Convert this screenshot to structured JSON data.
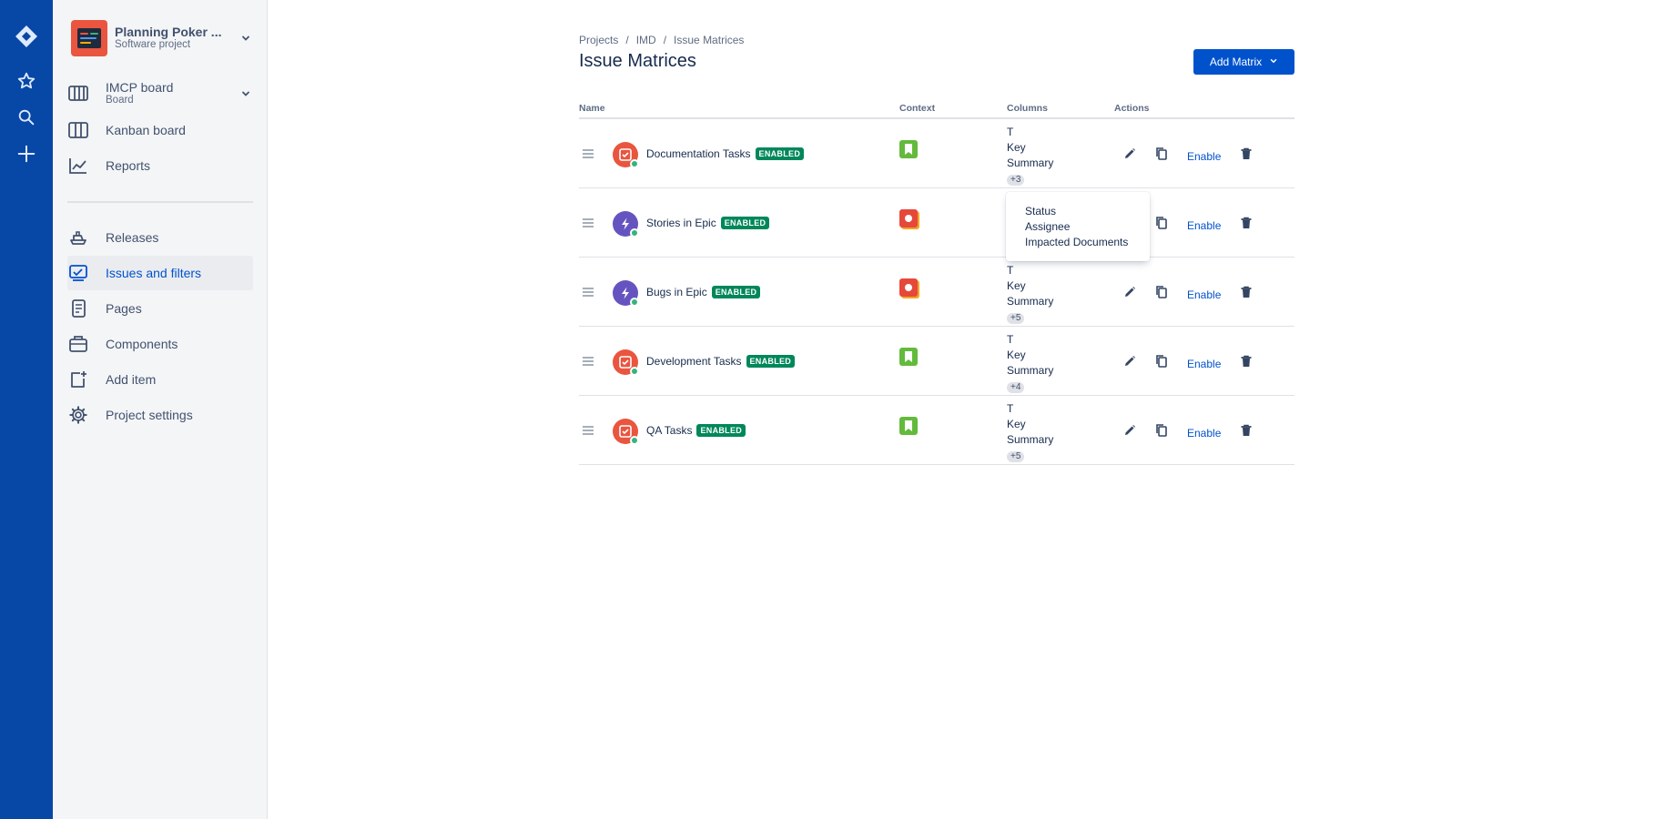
{
  "rail": {
    "items": [
      {
        "name": "jira-logo-icon"
      },
      {
        "name": "starred-icon"
      },
      {
        "name": "search-icon"
      },
      {
        "name": "create-icon"
      }
    ]
  },
  "sidebar": {
    "project": {
      "name": "Planning Poker ...",
      "type": "Software project"
    },
    "board": {
      "name": "IMCP board",
      "type": "Board"
    },
    "items": [
      {
        "label": "Kanban board",
        "icon": "kanban-icon"
      },
      {
        "label": "Reports",
        "icon": "reports-icon"
      },
      {
        "label": "Releases",
        "icon": "releases-icon"
      },
      {
        "label": "Issues and filters",
        "icon": "issues-icon",
        "active": true
      },
      {
        "label": "Pages",
        "icon": "pages-icon"
      },
      {
        "label": "Components",
        "icon": "components-icon"
      },
      {
        "label": "Add item",
        "icon": "add-item-icon"
      },
      {
        "label": "Project settings",
        "icon": "settings-icon"
      }
    ]
  },
  "breadcrumb": {
    "items": [
      "Projects",
      "IMD",
      "Issue Matrices"
    ],
    "separator": "/"
  },
  "page": {
    "title": "Issue Matrices",
    "add_button": "Add Matrix"
  },
  "table": {
    "headers": {
      "name": "Name",
      "context": "Context",
      "columns": "Columns",
      "actions": "Actions"
    },
    "status_label": "ENABLED",
    "enable_label": "Enable",
    "rows": [
      {
        "name": "Documentation Tasks",
        "issue_type": "task",
        "context": "story",
        "columns": [
          "T",
          "Key",
          "Summary"
        ],
        "more": "+3"
      },
      {
        "name": "Stories in Epic",
        "issue_type": "epic",
        "context": "bug",
        "columns": [],
        "more": ""
      },
      {
        "name": "Bugs in Epic",
        "issue_type": "epic",
        "context": "bug",
        "columns": [
          "T",
          "Key",
          "Summary"
        ],
        "more": "+5"
      },
      {
        "name": "Development Tasks",
        "issue_type": "task",
        "context": "story",
        "columns": [
          "T",
          "Key",
          "Summary"
        ],
        "more": "+4"
      },
      {
        "name": "QA Tasks",
        "issue_type": "task",
        "context": "story",
        "columns": [
          "T",
          "Key",
          "Summary"
        ],
        "more": "+5"
      }
    ]
  },
  "popover": {
    "items": [
      "Status",
      "Assignee",
      "Impacted Documents"
    ]
  },
  "colors": {
    "rail": "#0747A6",
    "primary": "#0052CC",
    "enabled": "#00875A",
    "task": "#E9553F",
    "epic": "#6554C0",
    "story": "#63BA3C",
    "bug": "#E5493A"
  }
}
